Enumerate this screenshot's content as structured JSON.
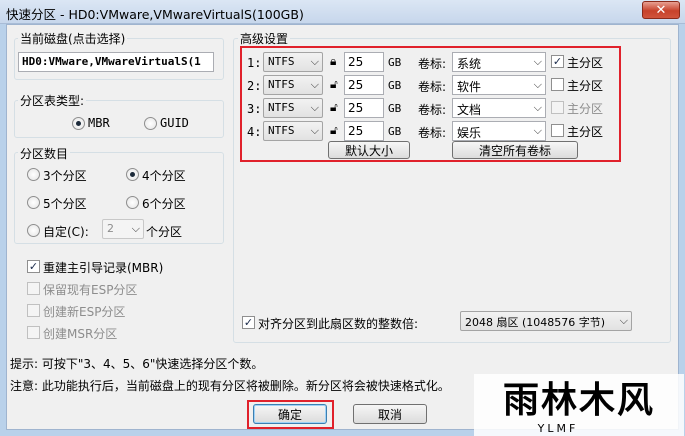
{
  "window": {
    "title": "快速分区 - HD0:VMware,VMwareVirtualS(100GB)",
    "close_glyph": "✕"
  },
  "disk": {
    "legend": "当前磁盘(点击选择)",
    "value": "HD0:VMware,VMwareVirtualS(1"
  },
  "partition_table": {
    "legend": "分区表类型:",
    "options": [
      "MBR",
      "GUID"
    ],
    "selected": "MBR"
  },
  "partition_count": {
    "legend": "分区数目",
    "options": [
      "3个分区",
      "4个分区",
      "5个分区",
      "6个分区"
    ],
    "selected": "4个分区",
    "custom_label": "自定(C):",
    "custom_value": "2",
    "custom_suffix": "个分区"
  },
  "options": {
    "rebuild_mbr": {
      "label": "重建主引导记录(MBR)",
      "checked": true
    },
    "keep_esp": {
      "label": "保留现有ESP分区",
      "checked": false
    },
    "create_esp": {
      "label": "创建新ESP分区",
      "checked": false
    },
    "create_msr": {
      "label": "创建MSR分区",
      "checked": false
    }
  },
  "advanced": {
    "legend": "高级设置",
    "unit": "GB",
    "label_caption": "卷标:",
    "primary_label": "主分区",
    "rows": [
      {
        "index": "1:",
        "fs": "NTFS",
        "size": "25",
        "label": "系统",
        "primary": true,
        "primary_disabled": false,
        "locked": true
      },
      {
        "index": "2:",
        "fs": "NTFS",
        "size": "25",
        "label": "软件",
        "primary": false,
        "primary_disabled": false,
        "locked": false
      },
      {
        "index": "3:",
        "fs": "NTFS",
        "size": "25",
        "label": "文档",
        "primary": false,
        "primary_disabled": true,
        "locked": false
      },
      {
        "index": "4:",
        "fs": "NTFS",
        "size": "25",
        "label": "娱乐",
        "primary": false,
        "primary_disabled": false,
        "locked": false
      }
    ],
    "default_size_button": "默认大小",
    "clear_labels_button": "清空所有卷标"
  },
  "align": {
    "label": "对齐分区到此扇区数的整数倍:",
    "checked": true,
    "value": "2048 扇区 (1048576 字节)"
  },
  "hints": {
    "tip": "提示: 可按下\"3、4、5、6\"快速选择分区个数。",
    "warning": "注意: 此功能执行后，当前磁盘上的现有分区将被删除。新分区将会被快速格式化。"
  },
  "buttons": {
    "ok": "确定",
    "cancel": "取消"
  },
  "logo": {
    "main": "雨林木风",
    "sub": "YLMF"
  },
  "colors": {
    "highlight": "#e0212b",
    "title_bg": "#c7d7ec",
    "close": "#c7422b"
  }
}
